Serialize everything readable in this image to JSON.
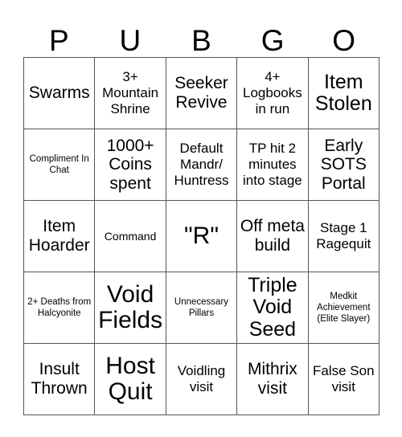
{
  "header": {
    "letters": [
      "P",
      "U",
      "B",
      "G",
      "O"
    ]
  },
  "colors": {
    "background": "#ffffff",
    "text": "#000000",
    "grid_line": "#555555"
  },
  "grid": {
    "columns": 5,
    "rows": 5,
    "cells": [
      {
        "text": "Swarms",
        "size": "lg"
      },
      {
        "text": "3+ Mountain Shrine",
        "size": "md"
      },
      {
        "text": "Seeker Revive",
        "size": "lg"
      },
      {
        "text": "4+ Logbooks in run",
        "size": "md"
      },
      {
        "text": "Item Stolen",
        "size": "xl"
      },
      {
        "text": "Compliment In Chat",
        "size": "xs"
      },
      {
        "text": "1000+ Coins spent",
        "size": "lg"
      },
      {
        "text": "Default Mandr/ Huntress",
        "size": "md"
      },
      {
        "text": "TP hit 2 minutes into stage",
        "size": "md"
      },
      {
        "text": "Early SOTS Portal",
        "size": "lg"
      },
      {
        "text": "Item Hoarder",
        "size": "lg"
      },
      {
        "text": "Command",
        "size": "sm"
      },
      {
        "text": "\"R\"",
        "size": "xxl"
      },
      {
        "text": "Off meta build",
        "size": "lg"
      },
      {
        "text": "Stage 1 Ragequit",
        "size": "md"
      },
      {
        "text": "2+ Deaths from Halcyonite",
        "size": "xs"
      },
      {
        "text": "Void Fields",
        "size": "xxl"
      },
      {
        "text": "Unnecessary Pillars",
        "size": "xs"
      },
      {
        "text": "Triple Void Seed",
        "size": "xl"
      },
      {
        "text": "Medkit Achievement (Elite Slayer)",
        "size": "xs"
      },
      {
        "text": "Insult Thrown",
        "size": "lg"
      },
      {
        "text": "Host Quit",
        "size": "xxl"
      },
      {
        "text": "Voidling visit",
        "size": "md"
      },
      {
        "text": "Mithrix visit",
        "size": "lg"
      },
      {
        "text": "False Son visit",
        "size": "md"
      }
    ]
  }
}
